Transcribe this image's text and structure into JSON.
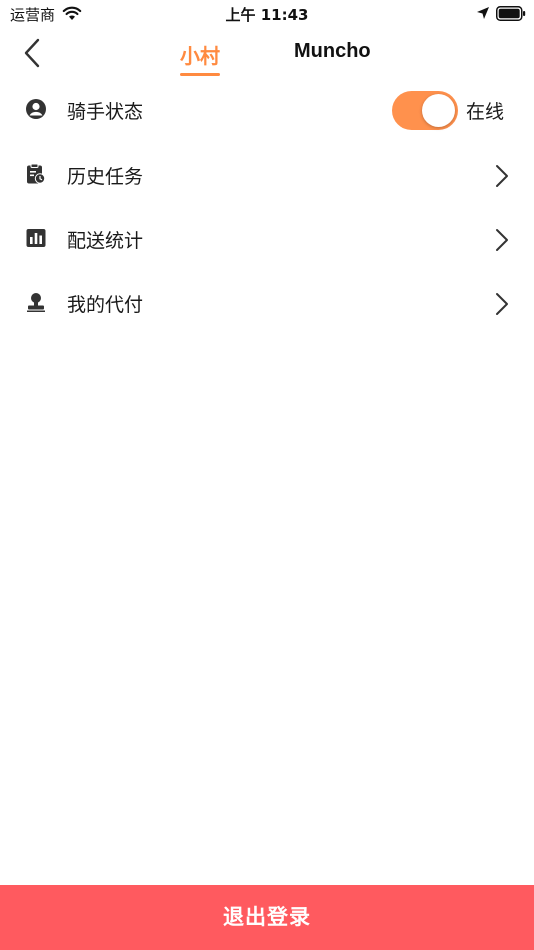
{
  "status_bar": {
    "carrier": "运营商",
    "time": "上午 11:43",
    "icons": [
      "wifi-icon",
      "location-arrow-icon",
      "battery-icon"
    ]
  },
  "nav": {
    "back_icon": "chevron-left-icon",
    "tabs": [
      {
        "label": "小村",
        "active": true
      },
      {
        "label": "Muncho",
        "active": false
      }
    ]
  },
  "menu": {
    "items": [
      {
        "label": "骑手状态",
        "icon": "user-circle-icon",
        "toggle": {
          "on": true,
          "status_label": "在线"
        }
      },
      {
        "label": "历史任务",
        "icon": "clipboard-clock-icon"
      },
      {
        "label": "配送统计",
        "icon": "bar-chart-icon"
      },
      {
        "label": "我的代付",
        "icon": "stamp-icon"
      }
    ]
  },
  "logout": {
    "label": "退出登录"
  },
  "colors": {
    "accent": "#ff8a40",
    "toggle_on": "#ff914d",
    "logout_bg": "#ff5a5f",
    "icon": "#333333"
  }
}
